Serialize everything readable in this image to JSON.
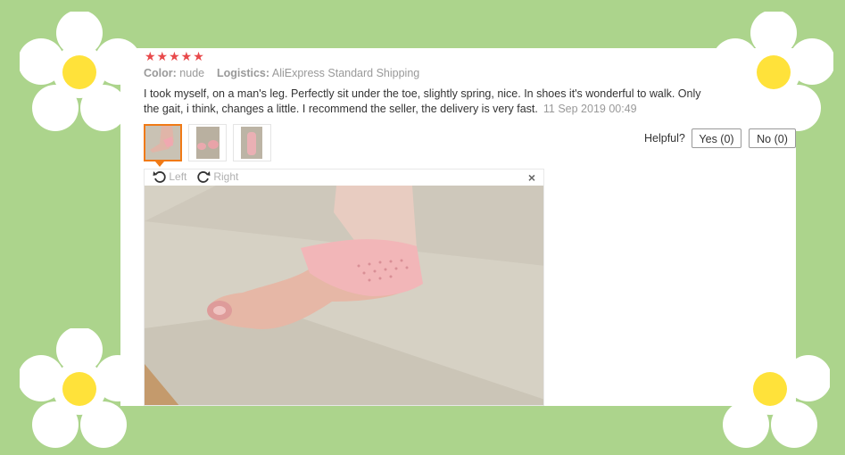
{
  "review": {
    "rating_stars": "★★★★★",
    "color_label": "Color:",
    "color_value": "nude",
    "logistics_label": "Logistics:",
    "logistics_value": "AliExpress Standard Shipping",
    "text": "I took myself, on a man's leg. Perfectly sit under the toe, slightly spring, nice. In shoes it's wonderful to walk. Only the gait, i think, changes a little. I recommend the seller, the delivery is very fast.",
    "date": "11 Sep 2019 00:49"
  },
  "helpful": {
    "label": "Helpful?",
    "yes_label": "Yes (0)",
    "no_label": "No (0)"
  },
  "viewer": {
    "rotate_left_label": "Left",
    "rotate_right_label": "Right",
    "close_glyph": "×"
  },
  "colors": {
    "background_green": "#acd48c",
    "star_red": "#e8494b",
    "accent_orange": "#f07a16",
    "flower_yellow": "#ffe23a"
  },
  "icons": [
    "star-icon",
    "rotate-left-icon",
    "rotate-right-icon",
    "close-icon",
    "flower-decoration"
  ]
}
